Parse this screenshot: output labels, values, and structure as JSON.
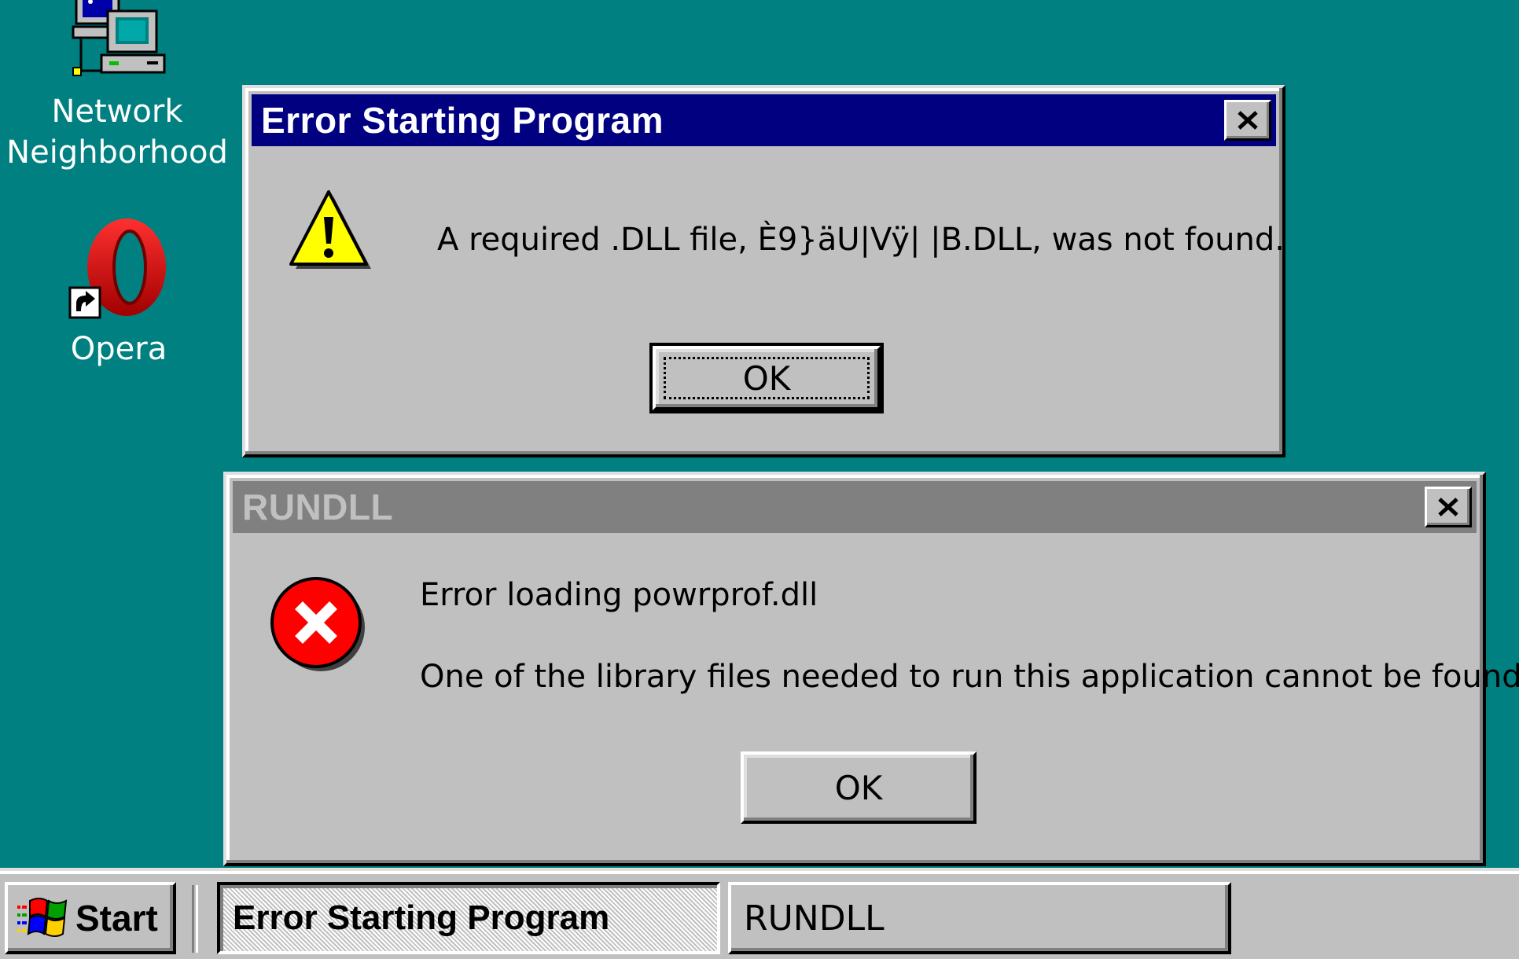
{
  "desktop": {
    "background_color": "#008080",
    "icons": [
      {
        "label": "Network Neighborhood",
        "icon": "network-computers-icon"
      },
      {
        "label": "Opera",
        "icon": "opera-icon"
      }
    ]
  },
  "dialogs": {
    "error_starting": {
      "title": "Error Starting Program",
      "icon": "warning-icon",
      "message": "A required .DLL file, È9}äU|Vÿ| |B.DLL, was not found.",
      "ok_label": "OK",
      "title_color": "#000080"
    },
    "rundll": {
      "title": "RUNDLL",
      "icon": "error-icon",
      "message_line1": "Error loading powrprof.dll",
      "message_line2": "One of the library files needed to run this application cannot be found.",
      "ok_label": "OK",
      "title_color": "#808080"
    }
  },
  "taskbar": {
    "start_label": "Start",
    "tasks": [
      {
        "label": "Error Starting Program",
        "active": true
      },
      {
        "label": "RUNDLL",
        "active": false
      }
    ]
  }
}
